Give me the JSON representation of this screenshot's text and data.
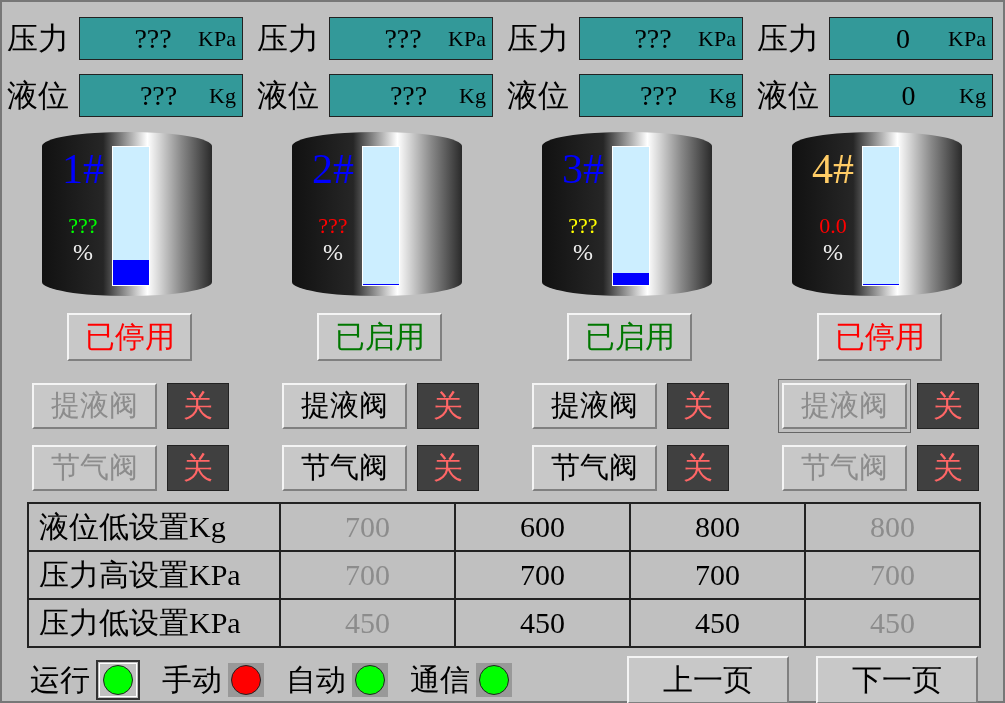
{
  "stations": [
    {
      "pressure_label": "压力",
      "pressure_value": "???",
      "pressure_unit": "KPa",
      "level_label": "液位",
      "level_value": "???",
      "level_unit": "Kg",
      "name": {
        "text": "1#",
        "color": "#0000ff"
      },
      "percent": {
        "text": "???",
        "color": "#00ff00"
      },
      "percent_sign": "%",
      "level": 0.18,
      "status": "已停用",
      "enabled": false,
      "valves": [
        {
          "label": "提液阀",
          "disabled": true,
          "focused": false,
          "state": "关"
        },
        {
          "label": "节气阀",
          "disabled": true,
          "focused": false,
          "state": "关"
        }
      ]
    },
    {
      "pressure_label": "压力",
      "pressure_value": "???",
      "pressure_unit": "KPa",
      "level_label": "液位",
      "level_value": "???",
      "level_unit": "Kg",
      "name": {
        "text": "2#",
        "color": "#0000ff"
      },
      "percent": {
        "text": "???",
        "color": "#ff0000"
      },
      "percent_sign": "%",
      "level": 0,
      "status": "已启用",
      "enabled": true,
      "valves": [
        {
          "label": "提液阀",
          "disabled": false,
          "focused": false,
          "state": "关"
        },
        {
          "label": "节气阀",
          "disabled": false,
          "focused": false,
          "state": "关"
        }
      ]
    },
    {
      "pressure_label": "压力",
      "pressure_value": "???",
      "pressure_unit": "KPa",
      "level_label": "液位",
      "level_value": "???",
      "level_unit": "Kg",
      "name": {
        "text": "3#",
        "color": "#0000ff"
      },
      "percent": {
        "text": "???",
        "color": "#ffff00"
      },
      "percent_sign": "%",
      "level": 0.09,
      "status": "已启用",
      "enabled": true,
      "valves": [
        {
          "label": "提液阀",
          "disabled": false,
          "focused": false,
          "state": "关"
        },
        {
          "label": "节气阀",
          "disabled": false,
          "focused": false,
          "state": "关"
        }
      ]
    },
    {
      "pressure_label": "压力",
      "pressure_value": "0",
      "pressure_unit": "KPa",
      "level_label": "液位",
      "level_value": "0",
      "level_unit": "Kg",
      "name": {
        "text": "4#",
        "color": "#ffcc66"
      },
      "percent": {
        "text": "0.0",
        "color": "#ff0000"
      },
      "percent_sign": "%",
      "level": 0,
      "status": "已停用",
      "enabled": false,
      "valves": [
        {
          "label": "提液阀",
          "disabled": true,
          "focused": true,
          "state": "关"
        },
        {
          "label": "节气阀",
          "disabled": true,
          "focused": false,
          "state": "关"
        }
      ]
    }
  ],
  "settings": [
    {
      "label": "液位低设置Kg",
      "cells": [
        {
          "text": "700",
          "disabled": true
        },
        {
          "text": "600",
          "disabled": false
        },
        {
          "text": "800",
          "disabled": false
        },
        {
          "text": "800",
          "disabled": true
        }
      ]
    },
    {
      "label": "压力高设置KPa",
      "cells": [
        {
          "text": "700",
          "disabled": true
        },
        {
          "text": "700",
          "disabled": false
        },
        {
          "text": "700",
          "disabled": false
        },
        {
          "text": "700",
          "disabled": true
        }
      ]
    },
    {
      "label": "压力低设置KPa",
      "cells": [
        {
          "text": "450",
          "disabled": true
        },
        {
          "text": "450",
          "disabled": false
        },
        {
          "text": "450",
          "disabled": false
        },
        {
          "text": "450",
          "disabled": true
        }
      ]
    }
  ],
  "indicators": [
    {
      "label": "运行",
      "kind": "framed",
      "color": "#00ff00"
    },
    {
      "label": "手动",
      "kind": "lamp",
      "color": "#ff0000"
    },
    {
      "label": "自动",
      "kind": "lamp",
      "color": "#00ff00"
    },
    {
      "label": "通信",
      "kind": "lamp",
      "color": "#00ff00"
    }
  ],
  "buttons": [
    "上一页",
    "下一页"
  ]
}
